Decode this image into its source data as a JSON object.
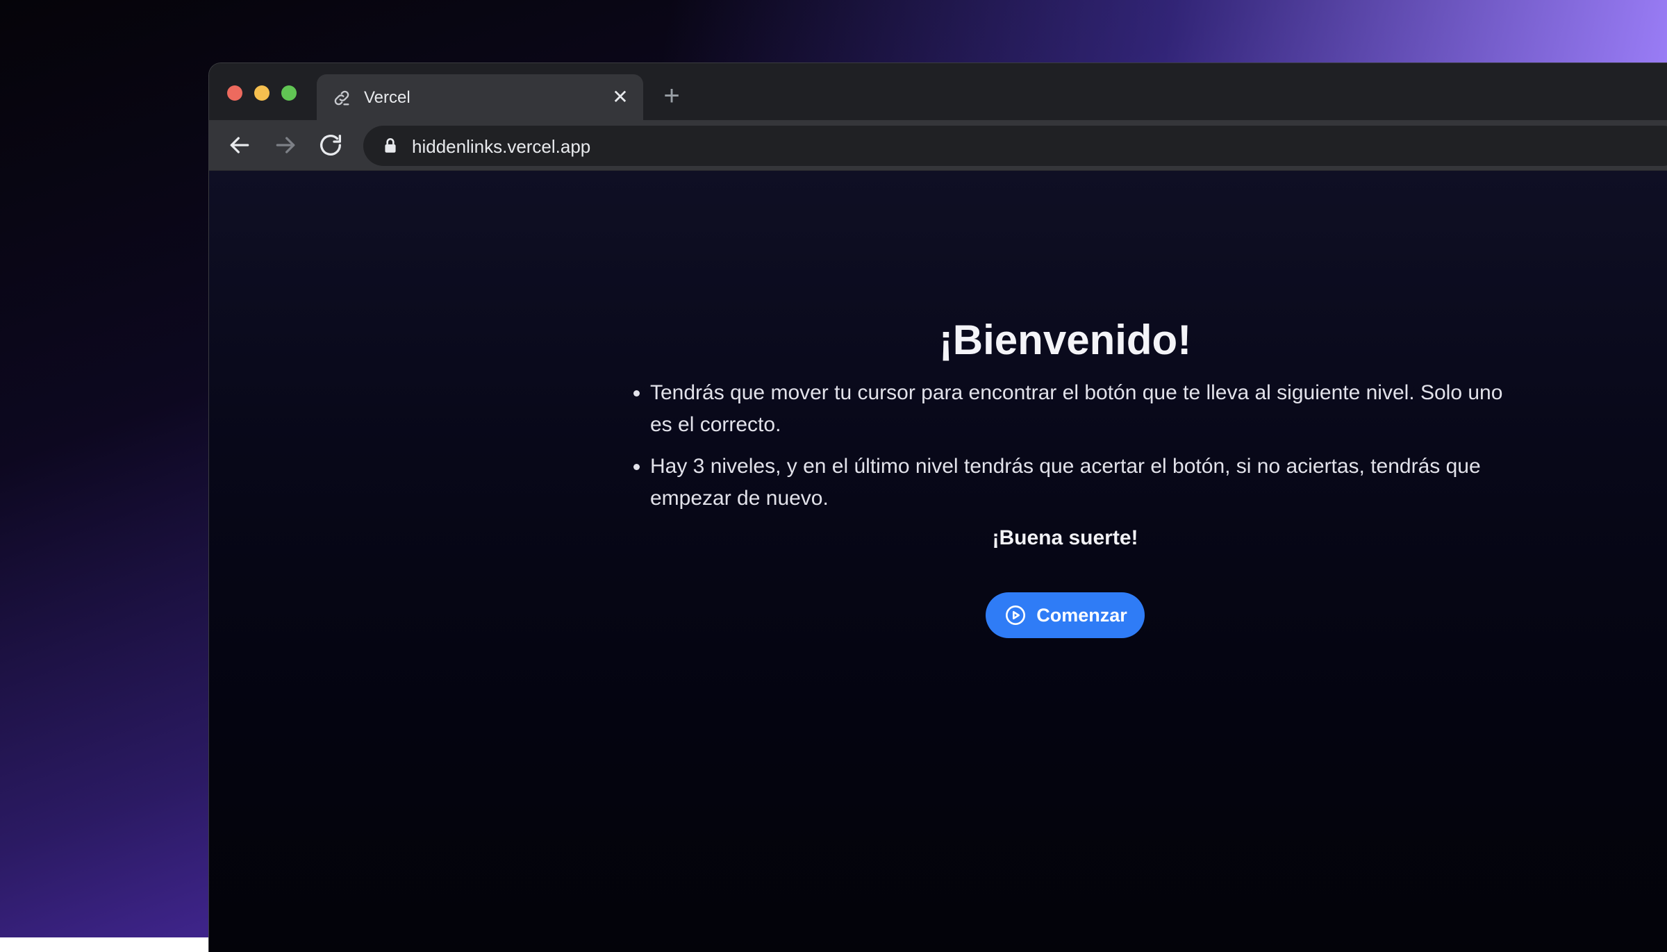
{
  "browser": {
    "tab": {
      "title": "Vercel",
      "favicon": "link-icon",
      "close_glyph": "✕"
    },
    "new_tab_glyph": "+",
    "address_bar": {
      "url": "hiddenlinks.vercel.app",
      "security_icon": "lock-icon"
    },
    "nav_icons": [
      "back-arrow-icon",
      "forward-arrow-icon",
      "reload-icon"
    ]
  },
  "page": {
    "title": "¡Bienvenido!",
    "rules": [
      "Tendrás que mover tu cursor para encontrar el botón que te lleva al siguiente nivel. Solo uno es el correcto.",
      "Hay 3 niveles, y en el último nivel tendrás que acertar el botón, si no aciertas, tendrás que empezar de nuevo."
    ],
    "good_luck": "¡Buena suerte!",
    "start_button": {
      "label": "Comenzar",
      "icon": "play-circle-icon",
      "color": "#2f7cf6"
    }
  },
  "colors": {
    "traffic_close": "#ed6a5e",
    "traffic_minimize": "#f5bf4f",
    "traffic_maximize": "#61c554"
  }
}
